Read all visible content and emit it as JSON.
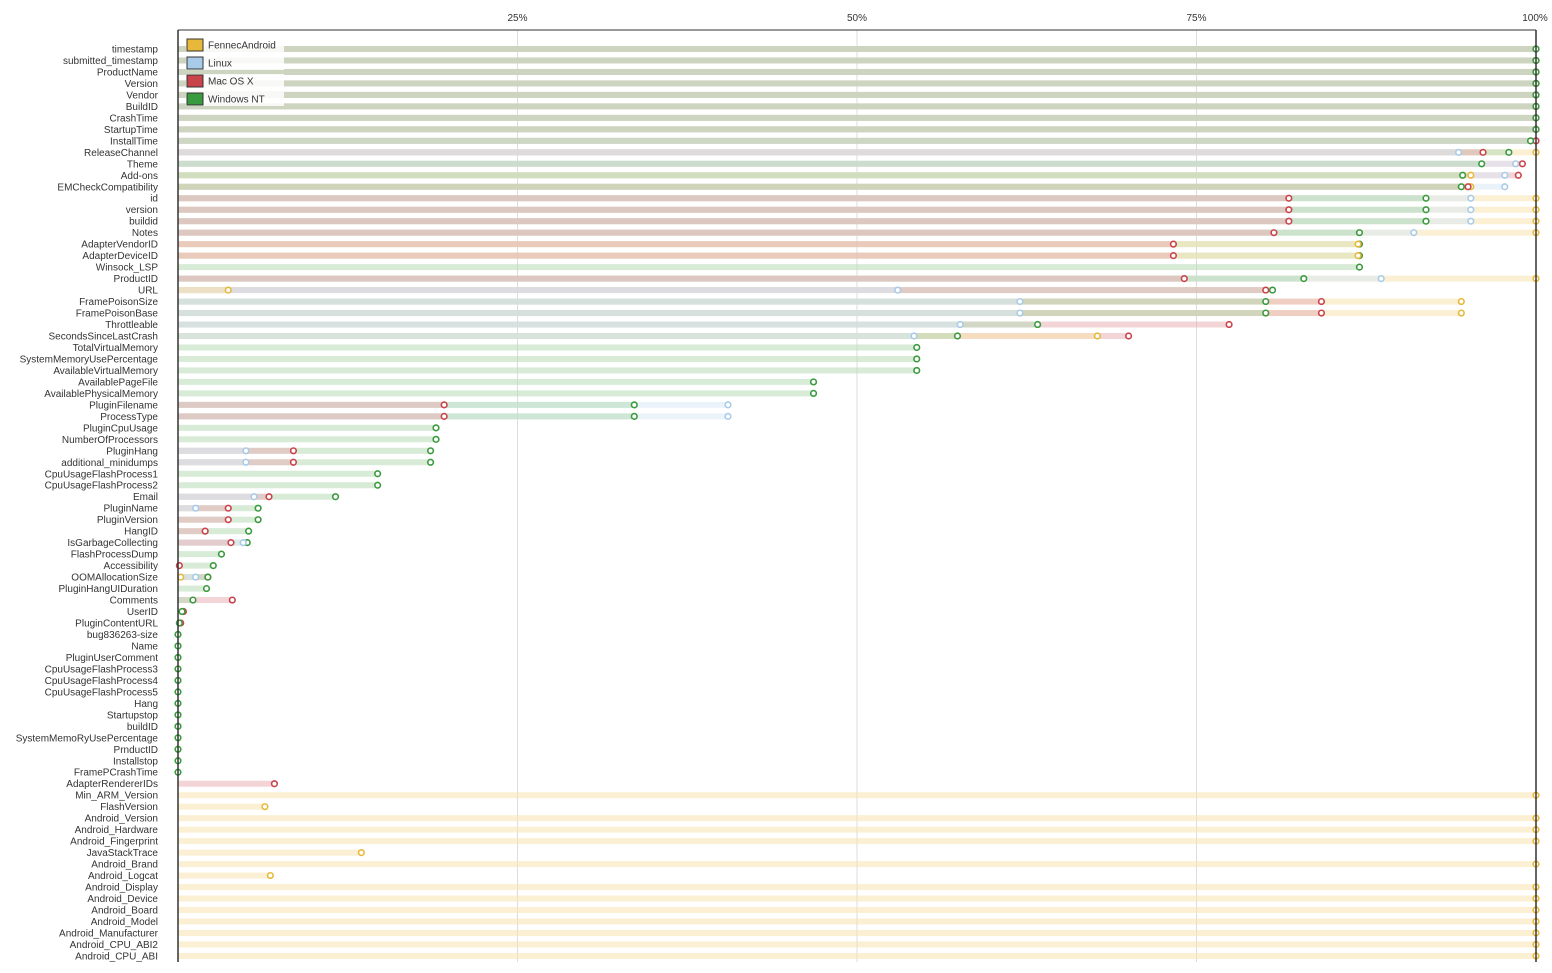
{
  "chart_data": {
    "type": "bar",
    "orientation": "horizontal",
    "xlim": [
      0,
      100
    ],
    "x_ticks": [
      "25%",
      "50%",
      "75%",
      "100%"
    ],
    "x_tick_values": [
      25,
      50,
      75,
      100
    ],
    "grid": true,
    "legend_position": "top-left",
    "legend": [
      {
        "name": "FennecAndroid",
        "color": "#e8b83a"
      },
      {
        "name": "Linux",
        "color": "#a8cbe9"
      },
      {
        "name": "Mac OS X",
        "color": "#c9434a"
      },
      {
        "name": "Windows NT",
        "color": "#3a9a3e"
      }
    ],
    "series_colors": {
      "fennec": "#e8b83a",
      "linux": "#a8cbe9",
      "mac": "#c9434a",
      "win": "#3a9a3e"
    },
    "series_bar_colors": {
      "fennec": "#f7e3ae",
      "linux": "#dbe9f5",
      "mac": "#e9b3b6",
      "win": "#b6dbb6"
    },
    "categories": [
      {
        "label": "timestamp",
        "fennec": 100,
        "linux": 100,
        "mac": 100,
        "win": 100
      },
      {
        "label": "submitted_timestamp",
        "fennec": 100,
        "linux": 100,
        "mac": 100,
        "win": 100
      },
      {
        "label": "ProductName",
        "fennec": 100,
        "linux": 100,
        "mac": 100,
        "win": 100
      },
      {
        "label": "Version",
        "fennec": 100,
        "linux": 100,
        "mac": 100,
        "win": 100
      },
      {
        "label": "Vendor",
        "fennec": 100,
        "linux": 100,
        "mac": 100,
        "win": 100
      },
      {
        "label": "BuildID",
        "fennec": 100,
        "linux": 100,
        "mac": 100,
        "win": 100
      },
      {
        "label": "CrashTime",
        "fennec": 100,
        "linux": 100,
        "mac": 100,
        "win": 100
      },
      {
        "label": "StartupTime",
        "fennec": 100,
        "linux": 100,
        "mac": 100,
        "win": 100
      },
      {
        "label": "InstallTime",
        "fennec": null,
        "linux": 100,
        "mac": 100,
        "win": 99.6
      },
      {
        "label": "ReleaseChannel",
        "fennec": 100,
        "linux": 94.3,
        "mac": 96.1,
        "win": 98.0
      },
      {
        "label": "Theme",
        "fennec": null,
        "linux": 98.5,
        "mac": 99.0,
        "win": 96.0
      },
      {
        "label": "Add-ons",
        "fennec": 95.2,
        "linux": 97.7,
        "mac": 98.7,
        "win": 94.6
      },
      {
        "label": "EMCheckCompatibility",
        "fennec": 95.2,
        "linux": 97.7,
        "mac": 95.0,
        "win": 94.5
      },
      {
        "label": "id",
        "fennec": 100,
        "linux": 95.2,
        "mac": 81.8,
        "win": 91.9
      },
      {
        "label": "version",
        "fennec": 100,
        "linux": 95.2,
        "mac": 81.8,
        "win": 91.9
      },
      {
        "label": "buildid",
        "fennec": 100,
        "linux": 95.2,
        "mac": 81.8,
        "win": 91.9
      },
      {
        "label": "Notes",
        "fennec": 100,
        "linux": 91.0,
        "mac": 80.7,
        "win": 87.0
      },
      {
        "label": "AdapterVendorID",
        "fennec": 86.9,
        "linux": null,
        "mac": 73.3,
        "win": 87.0
      },
      {
        "label": "AdapterDeviceID",
        "fennec": 86.9,
        "linux": null,
        "mac": 73.3,
        "win": 87.0
      },
      {
        "label": "Winsock_LSP",
        "fennec": null,
        "linux": null,
        "mac": null,
        "win": 87.0
      },
      {
        "label": "ProductID",
        "fennec": 100,
        "linux": 88.6,
        "mac": 74.1,
        "win": 82.9
      },
      {
        "label": "URL",
        "fennec": 3.7,
        "linux": 53.0,
        "mac": 80.1,
        "win": 80.6
      },
      {
        "label": "FramePoisonSize",
        "fennec": 94.5,
        "linux": 62.0,
        "mac": 84.2,
        "win": 80.1
      },
      {
        "label": "FramePoisonBase",
        "fennec": 94.5,
        "linux": 62.0,
        "mac": 84.2,
        "win": 80.1
      },
      {
        "label": "Throttleable",
        "fennec": null,
        "linux": 57.6,
        "mac": 77.4,
        "win": 63.3
      },
      {
        "label": "SecondsSinceLastCrash",
        "fennec": 67.7,
        "linux": 54.2,
        "mac": 70.0,
        "win": 57.4
      },
      {
        "label": "TotalVirtualMemory",
        "fennec": null,
        "linux": null,
        "mac": null,
        "win": 54.4
      },
      {
        "label": "SystemMemoryUsePercentage",
        "fennec": null,
        "linux": null,
        "mac": null,
        "win": 54.4
      },
      {
        "label": "AvailableVirtualMemory",
        "fennec": null,
        "linux": null,
        "mac": null,
        "win": 54.4
      },
      {
        "label": "AvailablePageFile",
        "fennec": null,
        "linux": null,
        "mac": null,
        "win": 46.8
      },
      {
        "label": "AvailablePhysicalMemory",
        "fennec": null,
        "linux": null,
        "mac": null,
        "win": 46.8
      },
      {
        "label": "PluginFilename",
        "fennec": null,
        "linux": 40.5,
        "mac": 19.6,
        "win": 33.6
      },
      {
        "label": "ProcessType",
        "fennec": null,
        "linux": 40.5,
        "mac": 19.6,
        "win": 33.6
      },
      {
        "label": "PluginCpuUsage",
        "fennec": null,
        "linux": null,
        "mac": null,
        "win": 19.0
      },
      {
        "label": "NumberOfProcessors",
        "fennec": null,
        "linux": null,
        "mac": null,
        "win": 19.0
      },
      {
        "label": "PluginHang",
        "fennec": null,
        "linux": 5.0,
        "mac": 8.5,
        "win": 18.6
      },
      {
        "label": "additional_minidumps",
        "fennec": null,
        "linux": 5.0,
        "mac": 8.5,
        "win": 18.6
      },
      {
        "label": "CpuUsageFlashProcess1",
        "fennec": null,
        "linux": null,
        "mac": null,
        "win": 14.7
      },
      {
        "label": "CpuUsageFlashProcess2",
        "fennec": null,
        "linux": null,
        "mac": null,
        "win": 14.7
      },
      {
        "label": "Email",
        "fennec": null,
        "linux": 5.6,
        "mac": 6.7,
        "win": 11.6
      },
      {
        "label": "PluginName",
        "fennec": null,
        "linux": 1.3,
        "mac": 3.7,
        "win": 5.9
      },
      {
        "label": "PluginVersion",
        "fennec": null,
        "linux": null,
        "mac": 3.7,
        "win": 5.9
      },
      {
        "label": "HangID",
        "fennec": null,
        "linux": null,
        "mac": 2.0,
        "win": 5.2
      },
      {
        "label": "IsGarbageCollecting",
        "fennec": null,
        "linux": 4.8,
        "mac": 3.9,
        "win": 5.1
      },
      {
        "label": "FlashProcessDump",
        "fennec": null,
        "linux": null,
        "mac": null,
        "win": 3.2
      },
      {
        "label": "Accessibility",
        "fennec": null,
        "linux": null,
        "mac": 0.1,
        "win": 2.6
      },
      {
        "label": "OOMAllocationSize",
        "fennec": 0.2,
        "linux": 1.3,
        "mac": 2.2,
        "win": 2.2
      },
      {
        "label": "PluginHangUIDuration",
        "fennec": null,
        "linux": null,
        "mac": null,
        "win": 2.1
      },
      {
        "label": "Comments",
        "fennec": null,
        "linux": null,
        "mac": 4.0,
        "win": 1.1
      },
      {
        "label": "UserID",
        "fennec": null,
        "linux": null,
        "mac": 0.4,
        "win": 0.3
      },
      {
        "label": "PluginContentURL",
        "fennec": null,
        "linux": null,
        "mac": 0.2,
        "win": 0.1
      },
      {
        "label": "bug836263-size",
        "fennec": null,
        "linux": null,
        "mac": null,
        "win": 0.0
      },
      {
        "label": "Name",
        "fennec": null,
        "linux": null,
        "mac": null,
        "win": 0.0
      },
      {
        "label": "PluginUserComment",
        "fennec": null,
        "linux": null,
        "mac": null,
        "win": 0.0
      },
      {
        "label": "CpuUsageFlashProcess3",
        "fennec": null,
        "linux": null,
        "mac": null,
        "win": 0.0
      },
      {
        "label": "CpuUsageFlashProcess4",
        "fennec": null,
        "linux": null,
        "mac": null,
        "win": 0.0
      },
      {
        "label": "CpuUsageFlashProcess5",
        "fennec": null,
        "linux": null,
        "mac": null,
        "win": 0.0
      },
      {
        "label": "Hang",
        "fennec": null,
        "linux": null,
        "mac": null,
        "win": 0.0
      },
      {
        "label": "Startupstop",
        "fennec": null,
        "linux": null,
        "mac": null,
        "win": 0.0
      },
      {
        "label": "buildID",
        "fennec": null,
        "linux": null,
        "mac": null,
        "win": 0.0
      },
      {
        "label": "SystemMemoRyUsePercentage",
        "fennec": null,
        "linux": null,
        "mac": null,
        "win": 0.0
      },
      {
        "label": "PrnductID",
        "fennec": null,
        "linux": null,
        "mac": null,
        "win": 0.0
      },
      {
        "label": "Installstop",
        "fennec": null,
        "linux": null,
        "mac": null,
        "win": 0.0
      },
      {
        "label": "FramePCrashTime",
        "fennec": null,
        "linux": null,
        "mac": null,
        "win": 0.0
      },
      {
        "label": "AdapterRendererIDs",
        "fennec": null,
        "linux": null,
        "mac": 7.1,
        "win": null
      },
      {
        "label": "Min_ARM_Version",
        "fennec": 100,
        "linux": null,
        "mac": null,
        "win": null
      },
      {
        "label": "FlashVersion",
        "fennec": 6.4,
        "linux": null,
        "mac": null,
        "win": null
      },
      {
        "label": "Android_Version",
        "fennec": 100,
        "linux": null,
        "mac": null,
        "win": null
      },
      {
        "label": "Android_Hardware",
        "fennec": 100,
        "linux": null,
        "mac": null,
        "win": null
      },
      {
        "label": "Android_Fingerprint",
        "fennec": 100,
        "linux": null,
        "mac": null,
        "win": null
      },
      {
        "label": "JavaStackTrace",
        "fennec": 13.5,
        "linux": null,
        "mac": null,
        "win": null
      },
      {
        "label": "Android_Brand",
        "fennec": 100,
        "linux": null,
        "mac": null,
        "win": null
      },
      {
        "label": "Android_Logcat",
        "fennec": 6.8,
        "linux": null,
        "mac": null,
        "win": null
      },
      {
        "label": "Android_Display",
        "fennec": 100,
        "linux": null,
        "mac": null,
        "win": null
      },
      {
        "label": "Android_Device",
        "fennec": 100,
        "linux": null,
        "mac": null,
        "win": null
      },
      {
        "label": "Android_Board",
        "fennec": 100,
        "linux": null,
        "mac": null,
        "win": null
      },
      {
        "label": "Android_Model",
        "fennec": 100,
        "linux": null,
        "mac": null,
        "win": null
      },
      {
        "label": "Android_Manufacturer",
        "fennec": 100,
        "linux": null,
        "mac": null,
        "win": null
      },
      {
        "label": "Android_CPU_ABI2",
        "fennec": 100,
        "linux": null,
        "mac": null,
        "win": null
      },
      {
        "label": "Android_CPU_ABI",
        "fennec": 100,
        "linux": null,
        "mac": null,
        "win": null
      }
    ]
  }
}
